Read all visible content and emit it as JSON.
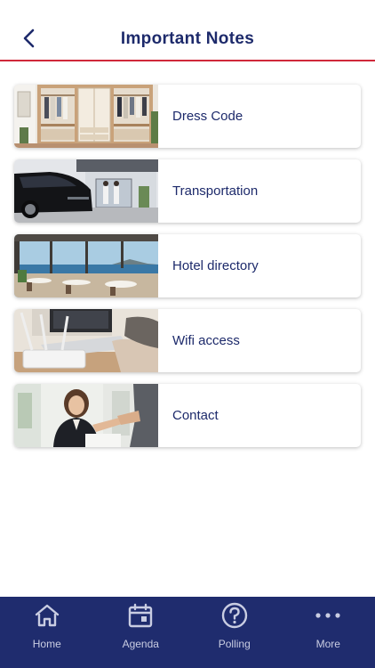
{
  "header": {
    "title": "Important Notes",
    "back_icon": "chevron-left-icon"
  },
  "colors": {
    "primary": "#1d2a6b",
    "accent": "#d0283a",
    "tabbar": "#1f2c6e"
  },
  "notes": [
    {
      "label": "Dress Code",
      "image": "wardrobe-photo"
    },
    {
      "label": "Transportation",
      "image": "car-hotel-entrance-photo"
    },
    {
      "label": "Hotel directory",
      "image": "hotel-restaurant-seaview-photo"
    },
    {
      "label": "Wifi access",
      "image": "router-laptop-photo"
    },
    {
      "label": "Contact",
      "image": "handshake-businesswoman-photo"
    }
  ],
  "tabbar": [
    {
      "label": "Home",
      "icon": "home-icon"
    },
    {
      "label": "Agenda",
      "icon": "calendar-icon"
    },
    {
      "label": "Polling",
      "icon": "question-circle-icon"
    },
    {
      "label": "More",
      "icon": "more-dots-icon"
    }
  ]
}
